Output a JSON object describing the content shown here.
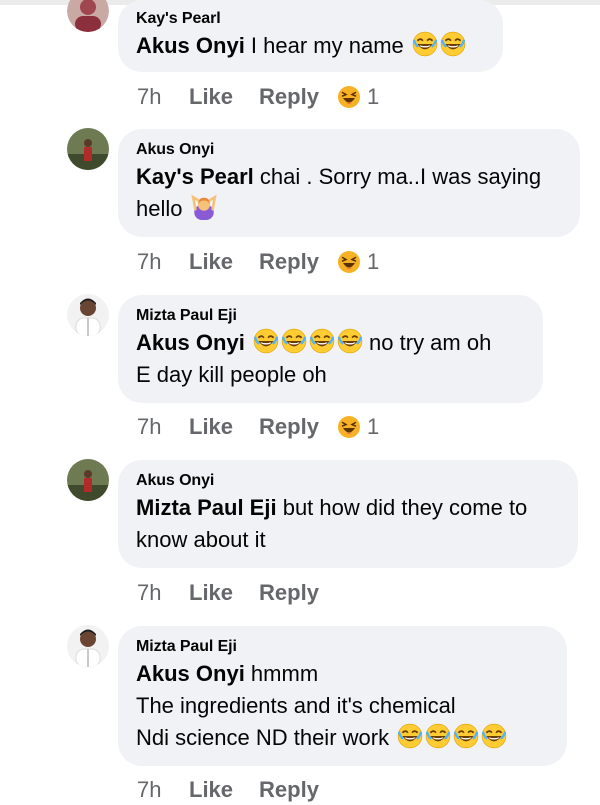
{
  "comments": [
    {
      "author": "Kay's Pearl",
      "mention": "Akus Onyi",
      "text1": " I hear my name ",
      "text2": "",
      "text3": "",
      "time": "7h",
      "like": "Like",
      "reply": "Reply",
      "reaction_count": "1",
      "avatar": "avatar-girl-red"
    },
    {
      "author": "Akus Onyi",
      "mention": "Kay's Pearl",
      "text1": " chai . Sorry ma..I was saying",
      "text2": "hello ",
      "text3": "",
      "time": "7h",
      "like": "Like",
      "reply": "Reply",
      "reaction_count": "1",
      "avatar": "avatar-person-field"
    },
    {
      "author": "Mizta Paul Eji",
      "mention": "Akus Onyi",
      "text1": " no try am oh",
      "text2": "E day kill people oh",
      "text3": "",
      "time": "7h",
      "like": "Like",
      "reply": "Reply",
      "reaction_count": "1",
      "avatar": "avatar-man-white"
    },
    {
      "author": "Akus Onyi",
      "mention": "Mizta Paul Eji",
      "text1": " but how did they come to",
      "text2": "know about it",
      "text3": "",
      "time": "7h",
      "like": "Like",
      "reply": "Reply",
      "avatar": "avatar-person-field"
    },
    {
      "author": "Mizta Paul Eji",
      "mention": "Akus Onyi",
      "text1": "  hmmm",
      "text2": "The ingredients and it's chemical",
      "text3": "Ndi science ND their work ",
      "time": "7h",
      "like": "Like",
      "reply": "Reply",
      "avatar": "avatar-man-white"
    }
  ],
  "colors": {
    "bubble": "#f0f2f5",
    "meta": "#65676b",
    "haha": "#f7b125"
  }
}
